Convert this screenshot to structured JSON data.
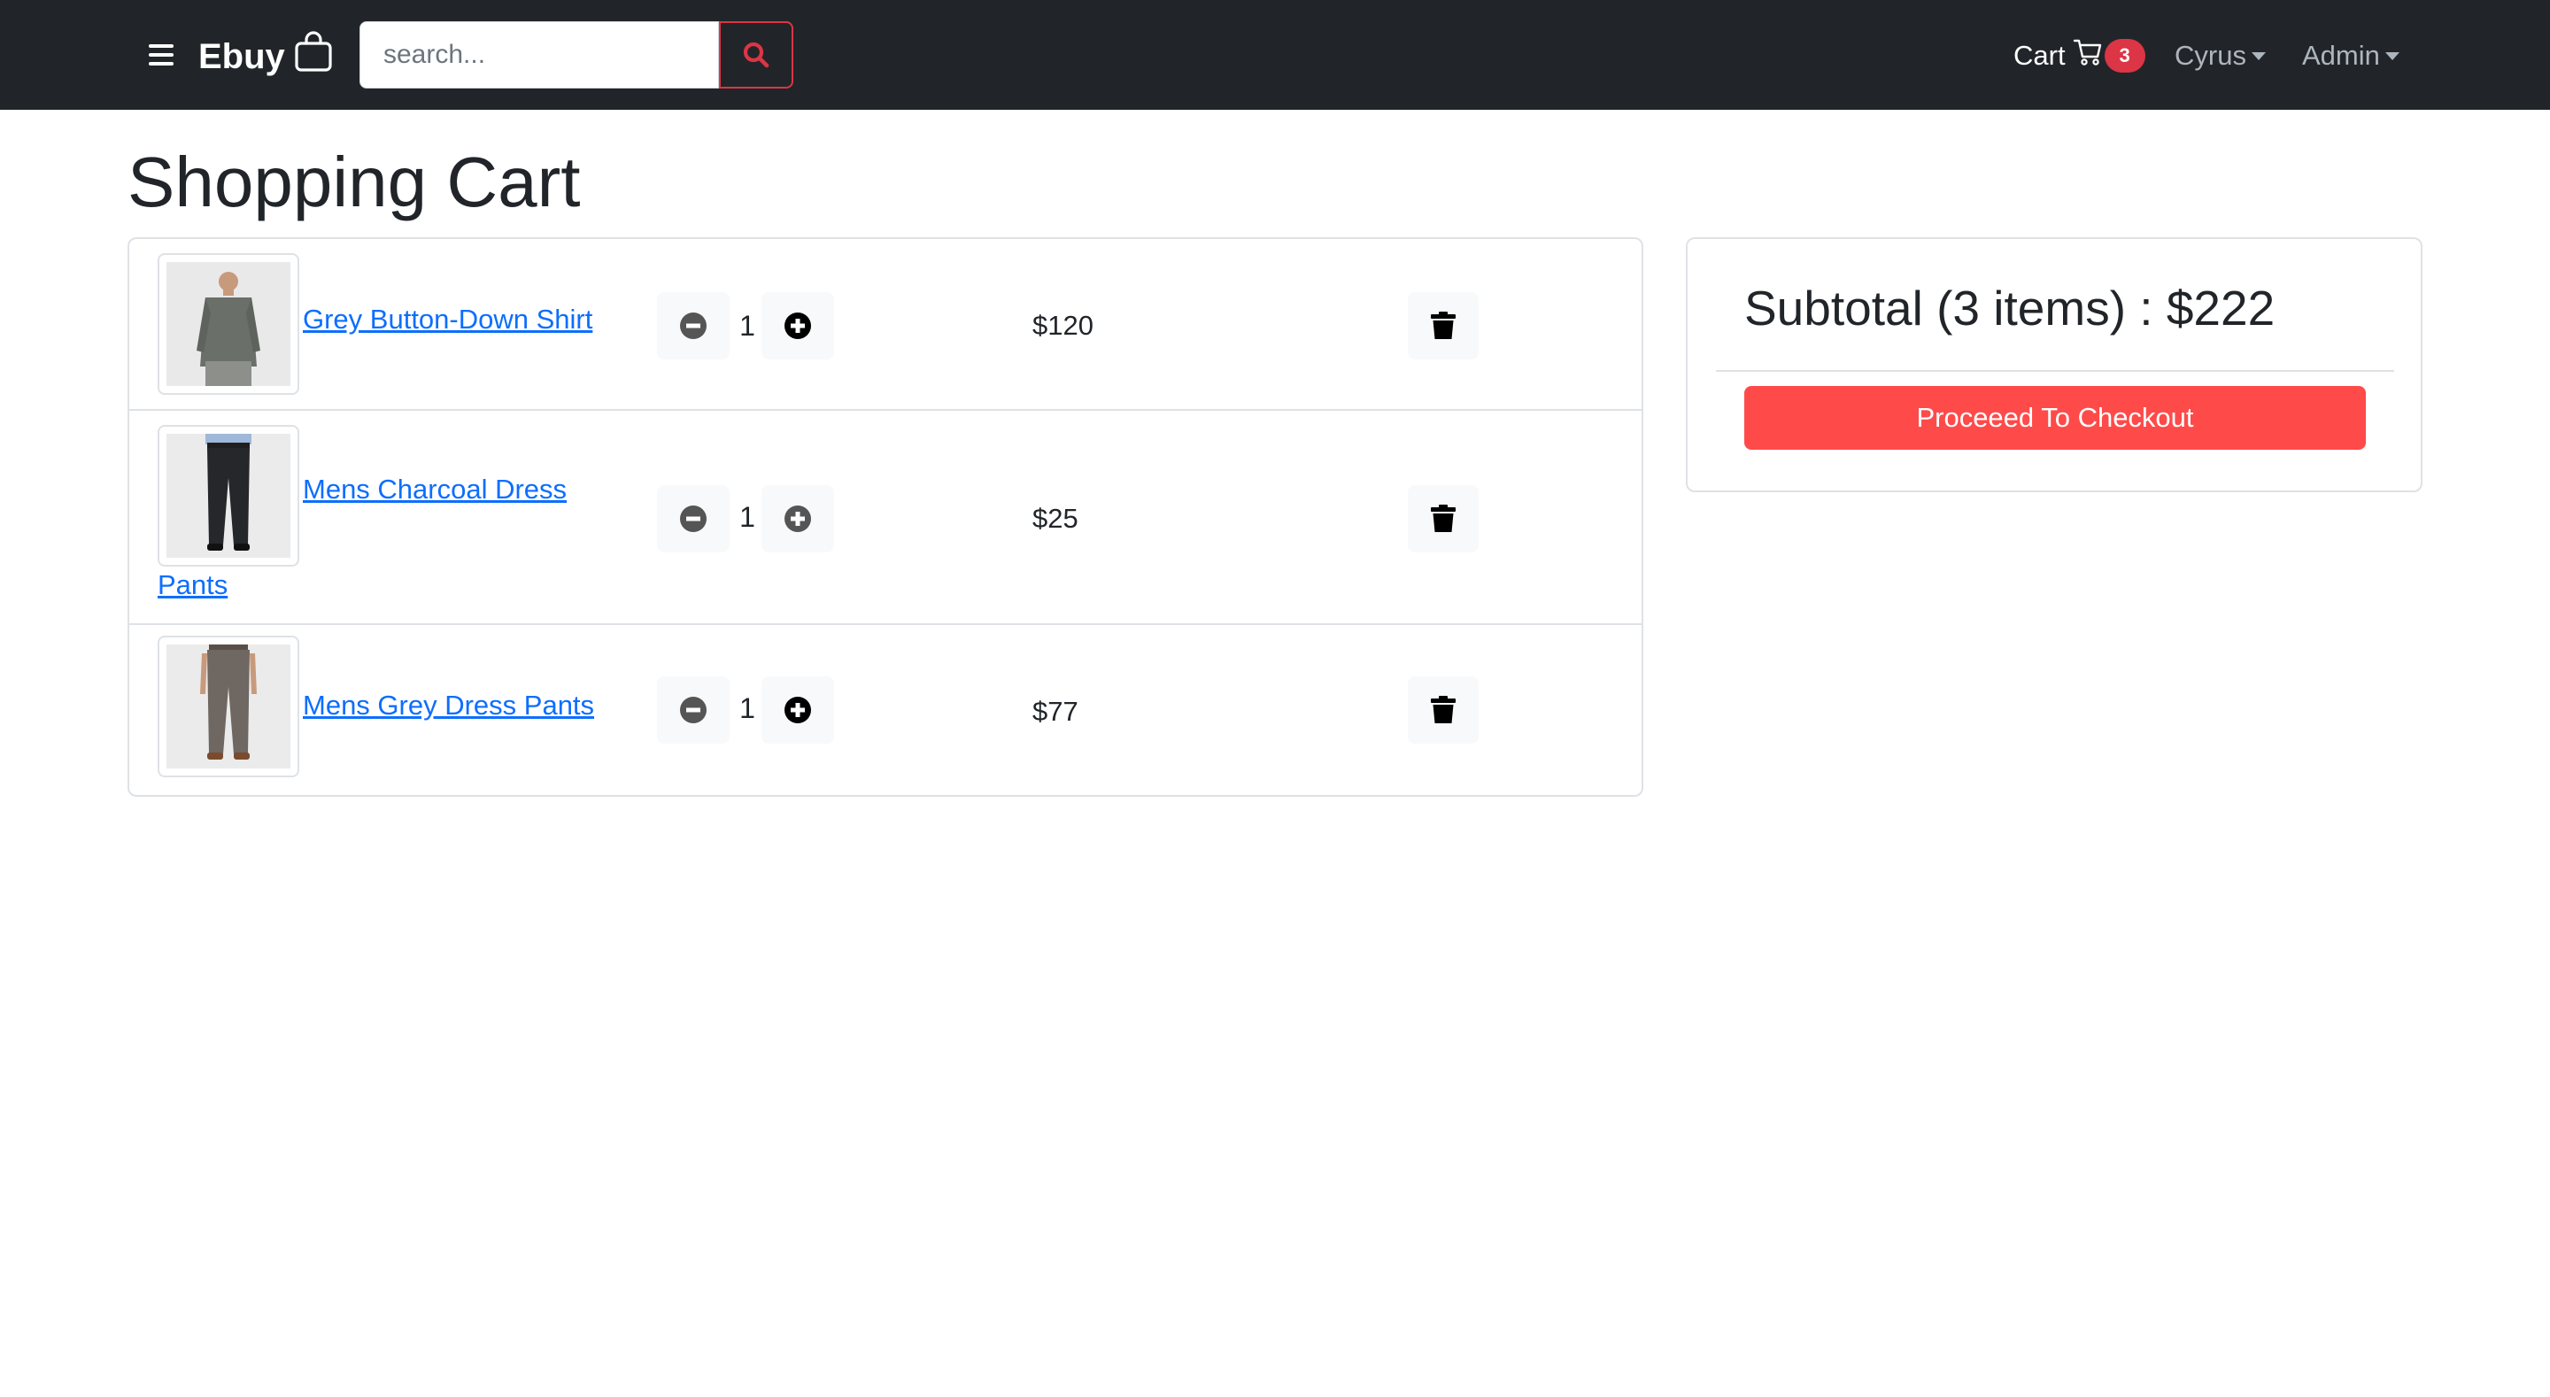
{
  "navbar": {
    "brand": "Ebuy",
    "search": {
      "placeholder": "search...",
      "value": ""
    },
    "cart_label": "Cart",
    "cart_count": "3",
    "user_menu": "Cyrus",
    "admin_menu": "Admin"
  },
  "page": {
    "title": "Shopping Cart"
  },
  "cart": {
    "items": [
      {
        "name": "Grey Button-Down Shirt",
        "quantity": "1",
        "price": "$120",
        "image": "grey-shirt-photo"
      },
      {
        "name_line1": "Mens Charcoal Dress",
        "name_line2": "Pants",
        "quantity": "1",
        "price": "$25",
        "image": "charcoal-pants-photo"
      },
      {
        "name": "Mens Grey Dress Pants",
        "quantity": "1",
        "price": "$77",
        "image": "grey-pants-photo"
      }
    ]
  },
  "summary": {
    "subtotal": "Subtotal (3 items) : $222",
    "checkout_label": "Proceeed To Checkout"
  },
  "colors": {
    "navbar_bg": "#212529",
    "badge": "#dc3545",
    "link": "#0d6efd",
    "checkout": "#ff4a4a"
  },
  "icons": [
    "menu-icon",
    "shopping-bag-icon",
    "search-icon",
    "cart-icon",
    "minus-circle-icon",
    "plus-circle-icon",
    "trash-icon"
  ]
}
